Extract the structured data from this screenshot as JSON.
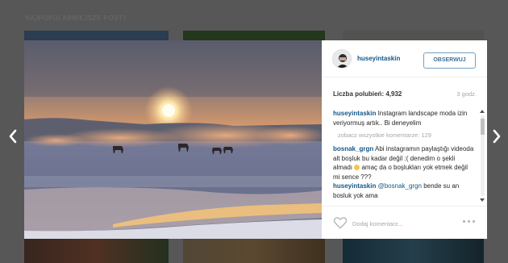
{
  "background": {
    "section_title": "NAJPOPULARNIEJSZE POSTY"
  },
  "post": {
    "username": "huseyintaskin",
    "follow_label": "OBSERWUJ",
    "likes_text": "Liczba polubień: 4,932",
    "time_text": "3 godz.",
    "caption": {
      "user": "huseyintaskin",
      "text": " Instagram landscape moda izin veriyormuş artık.. Bi deneyelim"
    },
    "view_all_comments": "zobacz wszystkie komentarze: 129",
    "comments": [
      {
        "user": "bosnak_grgn",
        "text_before": " Abi instagramın paylaştığı videoda alt boşluk bu kadar değil :( denedim o şekli almadı ",
        "text_after": " amaç da o boşlukları yok etmek değil mi sence ???"
      },
      {
        "user": "huseyintaskin",
        "mention": "@bosnak_grgn",
        "text": " bende su an bosluk yok ama"
      }
    ],
    "comment_placeholder": "Dodaj komentarz..."
  },
  "icons": {
    "prev": "chevron-left-icon",
    "next": "chevron-right-icon",
    "like": "heart-icon",
    "options": "more-options-icon",
    "emoji": "smile-emoji-icon"
  },
  "colors": {
    "overlay": "#575757",
    "username_link": "#125688",
    "follow_border": "#70a1c8",
    "follow_text": "#3f729b",
    "muted_text": "#a5a7aa"
  }
}
